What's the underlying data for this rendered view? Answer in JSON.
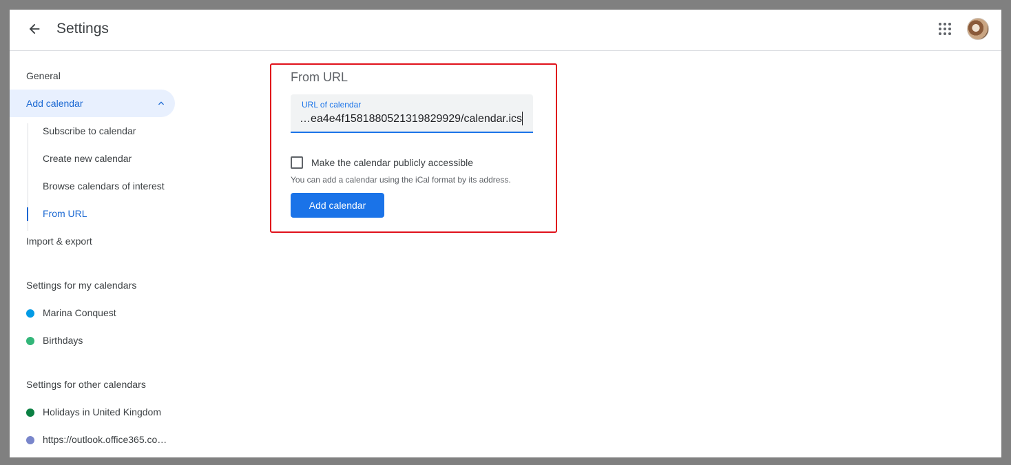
{
  "header": {
    "title": "Settings",
    "back_icon": "arrow-back-icon",
    "apps_icon": "apps-grid-icon",
    "avatar_icon": "account-avatar"
  },
  "sidebar": {
    "general": "General",
    "add_calendar": {
      "label": "Add calendar",
      "expanded": true,
      "children": [
        "Subscribe to calendar",
        "Create new calendar",
        "Browse calendars of interest",
        "From URL"
      ],
      "active_child": "From URL"
    },
    "import_export": "Import & export",
    "my_calendars_header": "Settings for my calendars",
    "my_calendars": [
      {
        "label": "Marina Conquest",
        "color": "#039be5"
      },
      {
        "label": "Birthdays",
        "color": "#33b679"
      }
    ],
    "other_calendars_header": "Settings for other calendars",
    "other_calendars": [
      {
        "label": "Holidays in United Kingdom",
        "color": "#0b8043"
      },
      {
        "label": "https://outlook.office365.co…",
        "color": "#7986cb"
      }
    ]
  },
  "main": {
    "section_title": "From URL",
    "url_field": {
      "label": "URL of calendar",
      "value": "…ea4e4f1581880521319829929/calendar.ics"
    },
    "checkbox": {
      "label": "Make the calendar publicly accessible",
      "checked": false
    },
    "helper_text": "You can add a calendar using the iCal format by its address.",
    "submit_label": "Add calendar"
  },
  "colors": {
    "accent": "#1a73e8",
    "selected_bg": "#e8f0fe",
    "highlight_border": "#e0101a"
  }
}
